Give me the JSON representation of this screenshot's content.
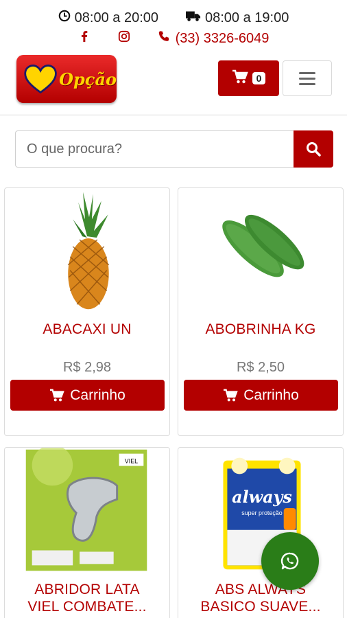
{
  "topbar": {
    "store_hours": "08:00 a 20:00",
    "delivery_hours": "08:00 a 19:00",
    "phone": "(33) 3326-6049",
    "icons": [
      "clock-icon",
      "truck-icon",
      "facebook-icon",
      "instagram-icon",
      "phone-icon"
    ]
  },
  "header": {
    "logo_text": "Opção",
    "cart_count": "0"
  },
  "search": {
    "placeholder": "O que procura?"
  },
  "products": [
    {
      "name": "ABACAXI UN",
      "price": "R$ 2,98",
      "button_label": "Carrinho"
    },
    {
      "name": "ABOBRINHA KG",
      "price": "R$ 2,50",
      "button_label": "Carrinho"
    },
    {
      "name_line1": "ABRIDOR LATA",
      "name_line2": "VIEL COMBATE...",
      "image_text": "VIEL"
    },
    {
      "name_line1": "ABS ALWAYS",
      "name_line2": "BASICO SUAVE...",
      "image_text_brand": "always",
      "image_text_sub": "super proteção"
    }
  ],
  "colors": {
    "brand_red": "#b30000",
    "whatsapp_green": "#2a7d18",
    "logo_yellow": "#ffd400"
  }
}
